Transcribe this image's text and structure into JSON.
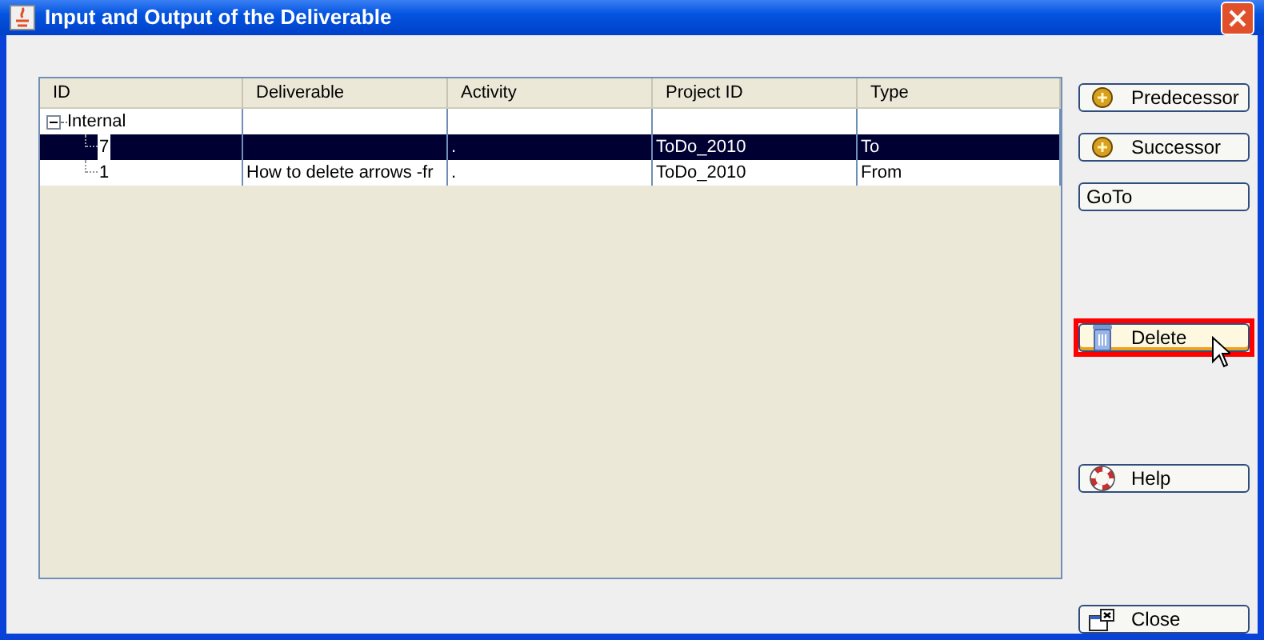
{
  "window": {
    "title": "Input and Output of the Deliverable"
  },
  "table": {
    "columns": [
      "ID",
      "Deliverable",
      "Activity",
      "Project ID",
      "Type"
    ],
    "tree": [
      {
        "label": "Internal",
        "expanded": true,
        "children": [
          {
            "cells": {
              "id": "7",
              "activity": ".",
              "project_id": "ToDo_2010",
              "type": "To"
            },
            "selected": true
          },
          {
            "cells": {
              "id": "1",
              "deliverable": "How to delete arrows -fr",
              "activity": ".",
              "project_id": "ToDo_2010",
              "type": "From"
            },
            "selected": false
          }
        ]
      }
    ]
  },
  "buttons": [
    {
      "label": "Predecessor",
      "kind": "coin",
      "highlighted": false
    },
    {
      "label": "Successor",
      "kind": "coin",
      "highlighted": false
    },
    {
      "label": "GoTo",
      "kind": "plain",
      "highlighted": false
    },
    {
      "label": "Delete",
      "kind": "trash",
      "highlighted": true
    },
    {
      "label": "Help",
      "kind": "lifebuoy",
      "highlighted": false
    },
    {
      "label": "Close",
      "kind": "window",
      "highlighted": false
    }
  ]
}
